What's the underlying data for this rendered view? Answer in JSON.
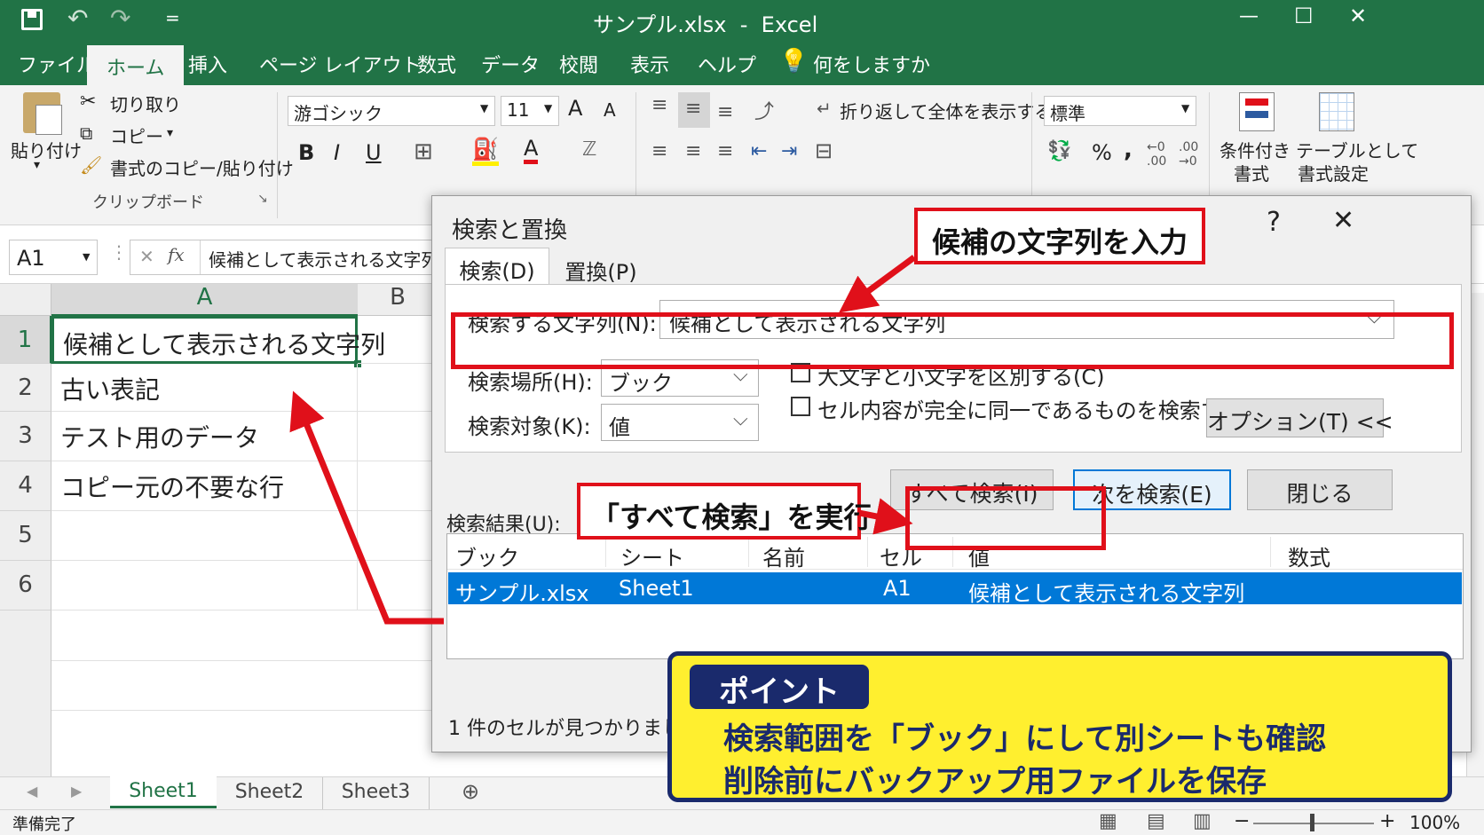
{
  "window": {
    "title": "サンプル.xlsx  -  Excel",
    "qat_more": "=",
    "min": "—",
    "max": "☐",
    "close": "✕"
  },
  "tabs": [
    "ファイル",
    "ホーム",
    "挿入",
    "ページ レイアウト",
    "数式",
    "データ",
    "校閲",
    "表示",
    "ヘルプ"
  ],
  "tellme": "何をしますか",
  "clipboard": {
    "paste": "貼り付け",
    "paste_arrow": "▾",
    "cut": "切り取り",
    "copy": "コピー",
    "copy_arrow": "▾",
    "format_painter": "書式のコピー/貼り付け",
    "group": "クリップボード"
  },
  "font": {
    "name": "游ゴシック",
    "size": "11",
    "grow": "A",
    "shrink": "A",
    "bold": "B",
    "italic": "I",
    "underline": "U"
  },
  "alignment": {
    "wrap": "折り返して全体を表示する"
  },
  "number": {
    "format": "標準",
    "percent": "%",
    "comma": ","
  },
  "styles": {
    "conditional_l1": "条件付き",
    "conditional_l2": "書式",
    "table_l1": "テーブルとして",
    "table_l2": "書式設定"
  },
  "formula_bar": {
    "namebox": "A1",
    "cancel": "✕",
    "fx": "fx",
    "value": "候補として表示される文字列"
  },
  "grid": {
    "col_a": "A",
    "col_b": "B",
    "rows": [
      {
        "num": "1",
        "a": "候補として表示される文字列"
      },
      {
        "num": "2",
        "a": "古い表記"
      },
      {
        "num": "3",
        "a": "テスト用のデータ"
      },
      {
        "num": "4",
        "a": "コピー元の不要な行"
      },
      {
        "num": "5",
        "a": ""
      },
      {
        "num": "6",
        "a": ""
      }
    ]
  },
  "sheets": [
    "Sheet1",
    "Sheet2",
    "Sheet3"
  ],
  "add_sheet": "⊕",
  "status": {
    "ready": "準備完了",
    "zoom": "100%",
    "minus": "−",
    "plus": "+"
  },
  "dialog": {
    "title": "検索と置換",
    "help": "?",
    "close": "✕",
    "tab_find": "検索(D)",
    "tab_replace": "置換(P)",
    "find_label": "検索する文字列(N):",
    "find_value": "候補として表示される文字列",
    "within_label": "検索場所(H):",
    "within_value": "ブック",
    "lookin_label": "検索対象(K):",
    "lookin_value": "値",
    "match_case": "大文字と小文字を区別する(C)",
    "match_entire": "セル内容が完全に同一であるものを検索する(O)",
    "options_button": "オプション(T) <<",
    "find_all_button": "すべて検索(I)",
    "find_next_button": "次を検索(E)",
    "close_button": "閉じる",
    "results_label": "検索結果(U):",
    "result_headers": [
      "ブック",
      "シート",
      "名前",
      "セル",
      "値",
      "数式"
    ],
    "result_row": [
      "サンプル.xlsx",
      "Sheet1",
      "",
      "A1",
      "候補として表示される文字列",
      ""
    ],
    "found_count": "1 件のセルが見つかりました"
  },
  "annotations": {
    "callout_input": "候補の文字列を入力",
    "callout_findall": "「すべて検索」を実行",
    "point_label": "ポイント",
    "point_line1": "検索範囲を「ブック」にして別シートも確認",
    "point_line2": "削除前にバックアップ用ファイルを保存"
  },
  "colors": {
    "excel_green": "#217346",
    "annotation_red": "#e0101a",
    "selection_blue": "#0078d7",
    "point_yellow": "#ffef2f",
    "point_navy": "#1a2a6c"
  }
}
